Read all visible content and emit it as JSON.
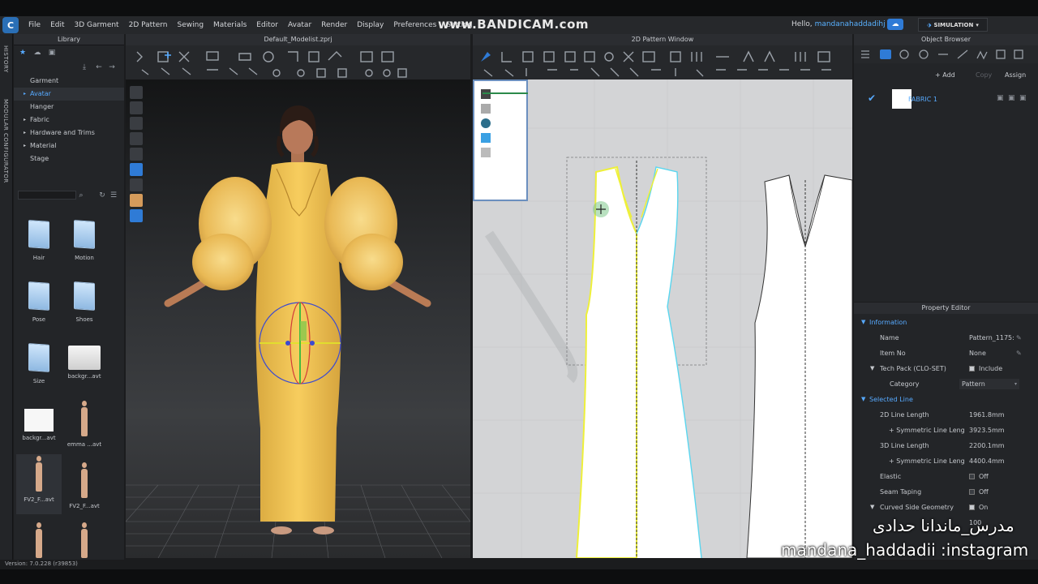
{
  "menubar": {
    "items": [
      "File",
      "Edit",
      "3D Garment",
      "2D Pattern",
      "Sewing",
      "Materials",
      "Editor",
      "Avatar",
      "Render",
      "Display",
      "Preferences",
      "Setting"
    ],
    "overlay_brand": "www.BANDICAM.com",
    "greeting": "Hello,",
    "username": "mandanahaddadihj",
    "simulation_label": "SIMULATION"
  },
  "side_tabs": {
    "history": "HISTORY",
    "modular": "MODULAR CONFIGURATOR"
  },
  "library": {
    "title": "Library",
    "tree": [
      {
        "label": "Garment",
        "expandable": false,
        "active": false
      },
      {
        "label": "Avatar",
        "expandable": true,
        "active": true
      },
      {
        "label": "Hanger",
        "expandable": false,
        "active": false
      },
      {
        "label": "Fabric",
        "expandable": true,
        "active": false
      },
      {
        "label": "Hardware and Trims",
        "expandable": true,
        "active": false
      },
      {
        "label": "Material",
        "expandable": true,
        "active": false
      },
      {
        "label": "Stage",
        "expandable": false,
        "active": false
      }
    ],
    "thumbs": [
      "Hair",
      "Motion",
      "Pose",
      "Shoes",
      "Size",
      "backgr...avt",
      "backgr...avt",
      "emma ...avt",
      "FV2_F...avt",
      "FV2_F...avt"
    ]
  },
  "windows": {
    "view3d_title": "Default_Modelist.zprj",
    "view2d_title": "2D Pattern Window"
  },
  "object_browser": {
    "title": "Object Browser",
    "add_label": "+ Add",
    "copy_label": "Copy",
    "assign_label": "Assign",
    "fabric_name": "FABRIC 1"
  },
  "property_editor": {
    "title": "Property Editor",
    "rows": [
      {
        "type": "section",
        "label": "Information"
      },
      {
        "type": "field",
        "label": "Name",
        "value": "Pattern_1175:"
      },
      {
        "type": "field",
        "label": "Item No",
        "value": "None"
      },
      {
        "type": "field",
        "label": "Tech Pack (CLO-SET)",
        "value": "Include",
        "checkbox": true,
        "checked": true,
        "caret": true
      },
      {
        "type": "field",
        "label": "Category",
        "value": "Pattern",
        "indent": true
      },
      {
        "type": "section",
        "label": "Selected Line"
      },
      {
        "type": "field",
        "label": "2D Line Length",
        "value": "1961.8mm"
      },
      {
        "type": "field",
        "label": "+ Symmetric Line Leng",
        "value": "3923.5mm",
        "indent": true
      },
      {
        "type": "field",
        "label": "3D Line Length",
        "value": "2200.1mm"
      },
      {
        "type": "field",
        "label": "+ Symmetric Line Leng",
        "value": "4400.4mm",
        "indent": true
      },
      {
        "type": "field",
        "label": "Elastic",
        "value": "Off",
        "checkbox": true,
        "checked": false
      },
      {
        "type": "field",
        "label": "Seam Taping",
        "value": "Off",
        "checkbox": true,
        "checked": false
      },
      {
        "type": "field",
        "label": "Curved Side Geometry",
        "value": "On",
        "checkbox": true,
        "checked": true,
        "caret": true
      },
      {
        "type": "field",
        "label": "",
        "value": "100"
      }
    ]
  },
  "watermark": {
    "line1": "مدرس_ماندانا حدادی",
    "line2": "mandana_haddadii :instagram"
  },
  "status": {
    "version": "Version: 7.0.228 (r39853)"
  },
  "colors": {
    "accent": "#57aaff",
    "dress": "#f3c75a",
    "pattern_outline_yellow": "#f0f23a",
    "pattern_outline_cyan": "#5ad6ef",
    "background": "#232528"
  }
}
